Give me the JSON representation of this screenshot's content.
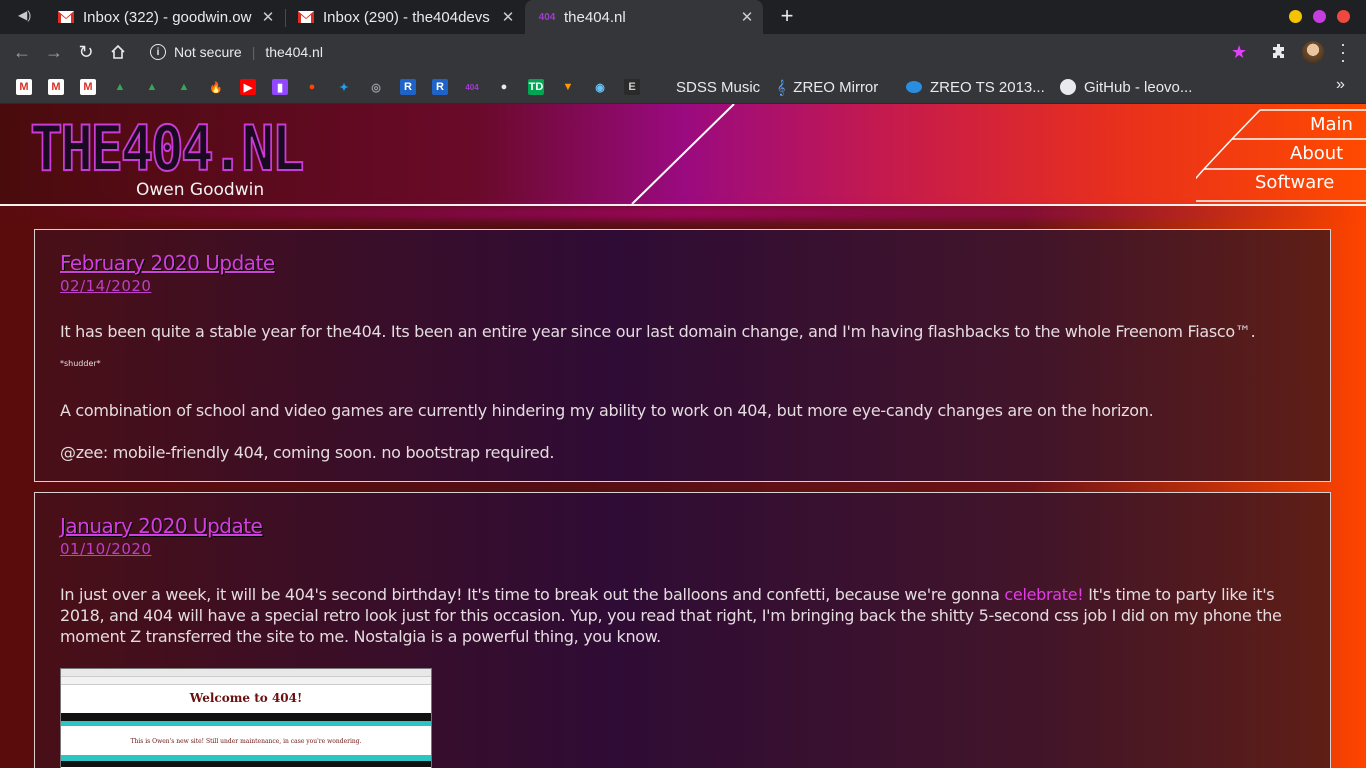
{
  "browser": {
    "tabs": [
      {
        "title": "Inbox (322) - goodwin.ow",
        "icon": "gmail-icon"
      },
      {
        "title": "Inbox (290) - the404devs",
        "icon": "gmail-icon"
      },
      {
        "title": "the404.nl",
        "icon": "the404-icon",
        "active": true
      }
    ],
    "omnibox": {
      "security": "Not secure",
      "url": "the404.nl"
    },
    "bookmarks": [
      {
        "label": "SDSS Music"
      },
      {
        "label": "ZREO Mirror"
      },
      {
        "label": "ZREO TS 2013..."
      },
      {
        "label": "GitHub - leovo..."
      }
    ],
    "bookmark_icons": [
      "gmail",
      "gmail",
      "gmail",
      "drive",
      "drive",
      "drive",
      "firebase",
      "youtube",
      "twitch",
      "reddit",
      "twitter",
      "aperture",
      "rl",
      "rl",
      "404",
      "github",
      "td",
      "feeder",
      "steam",
      "epic"
    ],
    "colors": {
      "tabbar": "#1f2024",
      "toolbar": "#35363a",
      "accent_star": "#e040fb"
    }
  },
  "site": {
    "logo": "THE404.NL",
    "author": "Owen Goodwin",
    "nav": [
      {
        "label": "Main"
      },
      {
        "label": "About"
      },
      {
        "label": "Software"
      }
    ],
    "posts": [
      {
        "title": "February 2020 Update",
        "date": "02/14/2020",
        "p1": "It has been quite a stable year for the404. Its been an entire year since our last domain change, and I'm having flashbacks to the whole Freenom Fiasco™.",
        "small": "*shudder*",
        "p2": "A combination of school and video games are currently hindering my ability to work on 404, but more eye-candy changes are on the horizon.",
        "p3": "@zee: mobile-friendly 404, coming soon. no bootstrap required."
      },
      {
        "title": "January 2020 Update",
        "date": "01/10/2020",
        "p1_before": "In just over a week, it will be 404's second birthday! It's time to break out the balloons and confetti, because we're gonna ",
        "p1_highlight": "celebrate!",
        "p1_after": " It's time to party like it's 2018, and 404 will have a special retro look just for this occasion. Yup, you read that right, I'm bringing back the shitty 5-second css job I did on my phone the moment Z transferred the site to me. Nostalgia is a powerful thing, you know.",
        "screenshot": {
          "heading": "Welcome to 404!",
          "sub": "This is Owen's new site! Still under maintenance, in case you're wondering."
        }
      }
    ]
  }
}
